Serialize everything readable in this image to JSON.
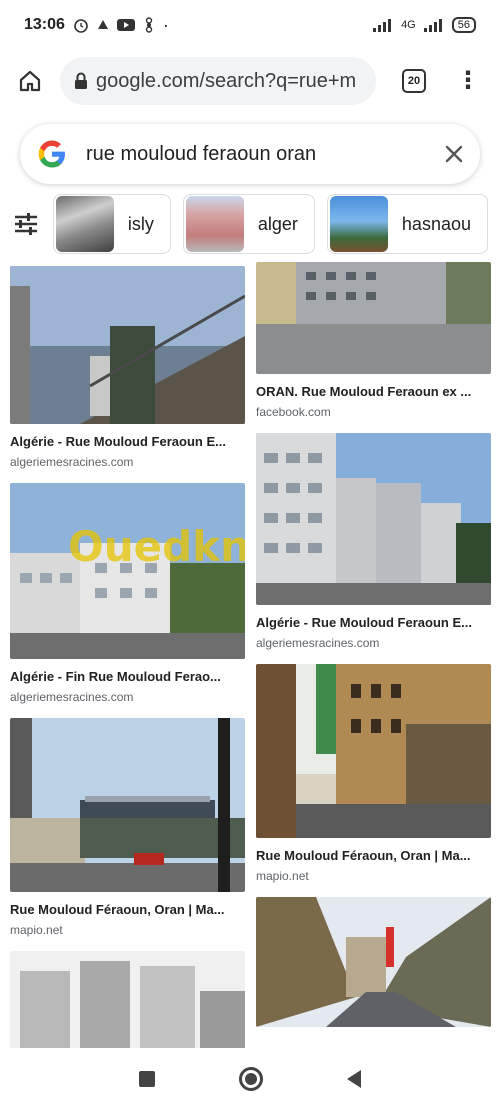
{
  "status": {
    "time": "13:06",
    "battery": "56",
    "network": "4G"
  },
  "browser": {
    "url": "google.com/search?q=rue+m",
    "tab_count": "20"
  },
  "search": {
    "query": "rue mouloud feraoun oran"
  },
  "chips": [
    {
      "label": "isly"
    },
    {
      "label": "alger"
    },
    {
      "label": "hasnaou"
    }
  ],
  "results": {
    "left": [
      {
        "title": "Algérie - Rue Mouloud Feraoun E...",
        "source": "algeriemesracines.com"
      },
      {
        "title": "Algérie - Fin Rue Mouloud Ferao...",
        "source": "algeriemesracines.com"
      },
      {
        "title": "Rue Mouloud Féraoun, Oran | Ma...",
        "source": "mapio.net"
      }
    ],
    "right": [
      {
        "title": "ORAN. Rue Mouloud Feraoun ex ...",
        "source": "facebook.com"
      },
      {
        "title": "Algérie - Rue Mouloud Feraoun E...",
        "source": "algeriemesracines.com"
      },
      {
        "title": "Rue Mouloud Féraoun, Oran | Ma...",
        "source": "mapio.net"
      }
    ]
  },
  "watermark": "Ouedkniss"
}
